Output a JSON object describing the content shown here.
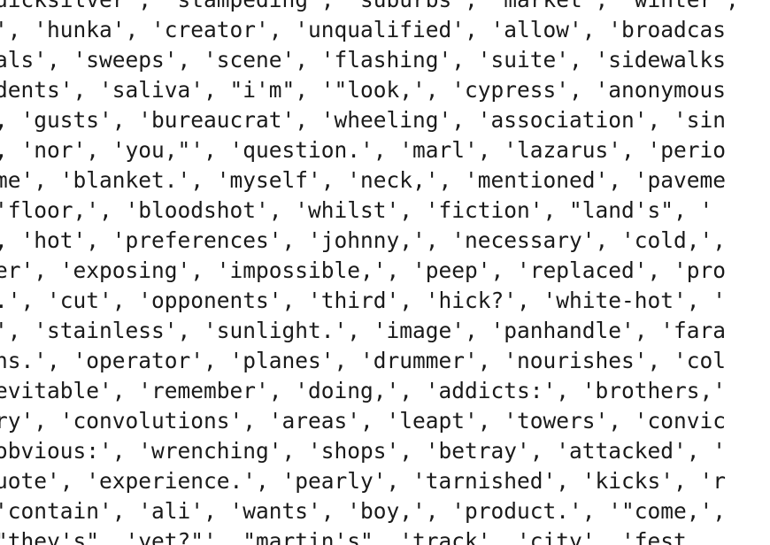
{
  "lines": [
    "uicksilver', 'stampeding', 'suburbs', 'market', 'winter',",
    "', 'hunka', 'creator', 'unqualified', 'allow', 'broadcas",
    "als', 'sweeps', 'scene', 'flashing', 'suite', 'sidewalks",
    "dents', 'saliva', \"i'm\", '\"look,', 'cypress', 'anonymous",
    ", 'gusts', 'bureaucrat', 'wheeling', 'association', 'sin",
    ", 'nor', 'you,\"', 'question.', 'marl', 'lazarus', 'perio",
    "me', 'blanket.', 'myself', 'neck,', 'mentioned', 'paveme",
    "'floor,', 'bloodshot', 'whilst', 'fiction', \"land's\", '",
    ", 'hot', 'preferences', 'johnny,', 'necessary', 'cold,',",
    "er', 'exposing', 'impossible,', 'peep', 'replaced', 'pro",
    ".', 'cut', 'opponents', 'third', 'hick?', 'white-hot', '",
    "', 'stainless', 'sunlight.', 'image', 'panhandle', 'fara",
    "ns.', 'operator', 'planes', 'drummer', 'nourishes', 'col",
    "evitable', 'remember', 'doing,', 'addicts:', 'brothers,'",
    "ry', 'convolutions', 'areas', 'leapt', 'towers', 'convic",
    "obvious:', 'wrenching', 'shops', 'betray', 'attacked', '",
    "uote', 'experience.', 'pearly', 'tarnished', 'kicks', 'r",
    "'contain', 'ali', 'wants', 'boy,', 'product.', '\"come,',",
    "\"they's\", 'yet?\"', \"martin's\", 'track', 'city', 'fest"
  ]
}
